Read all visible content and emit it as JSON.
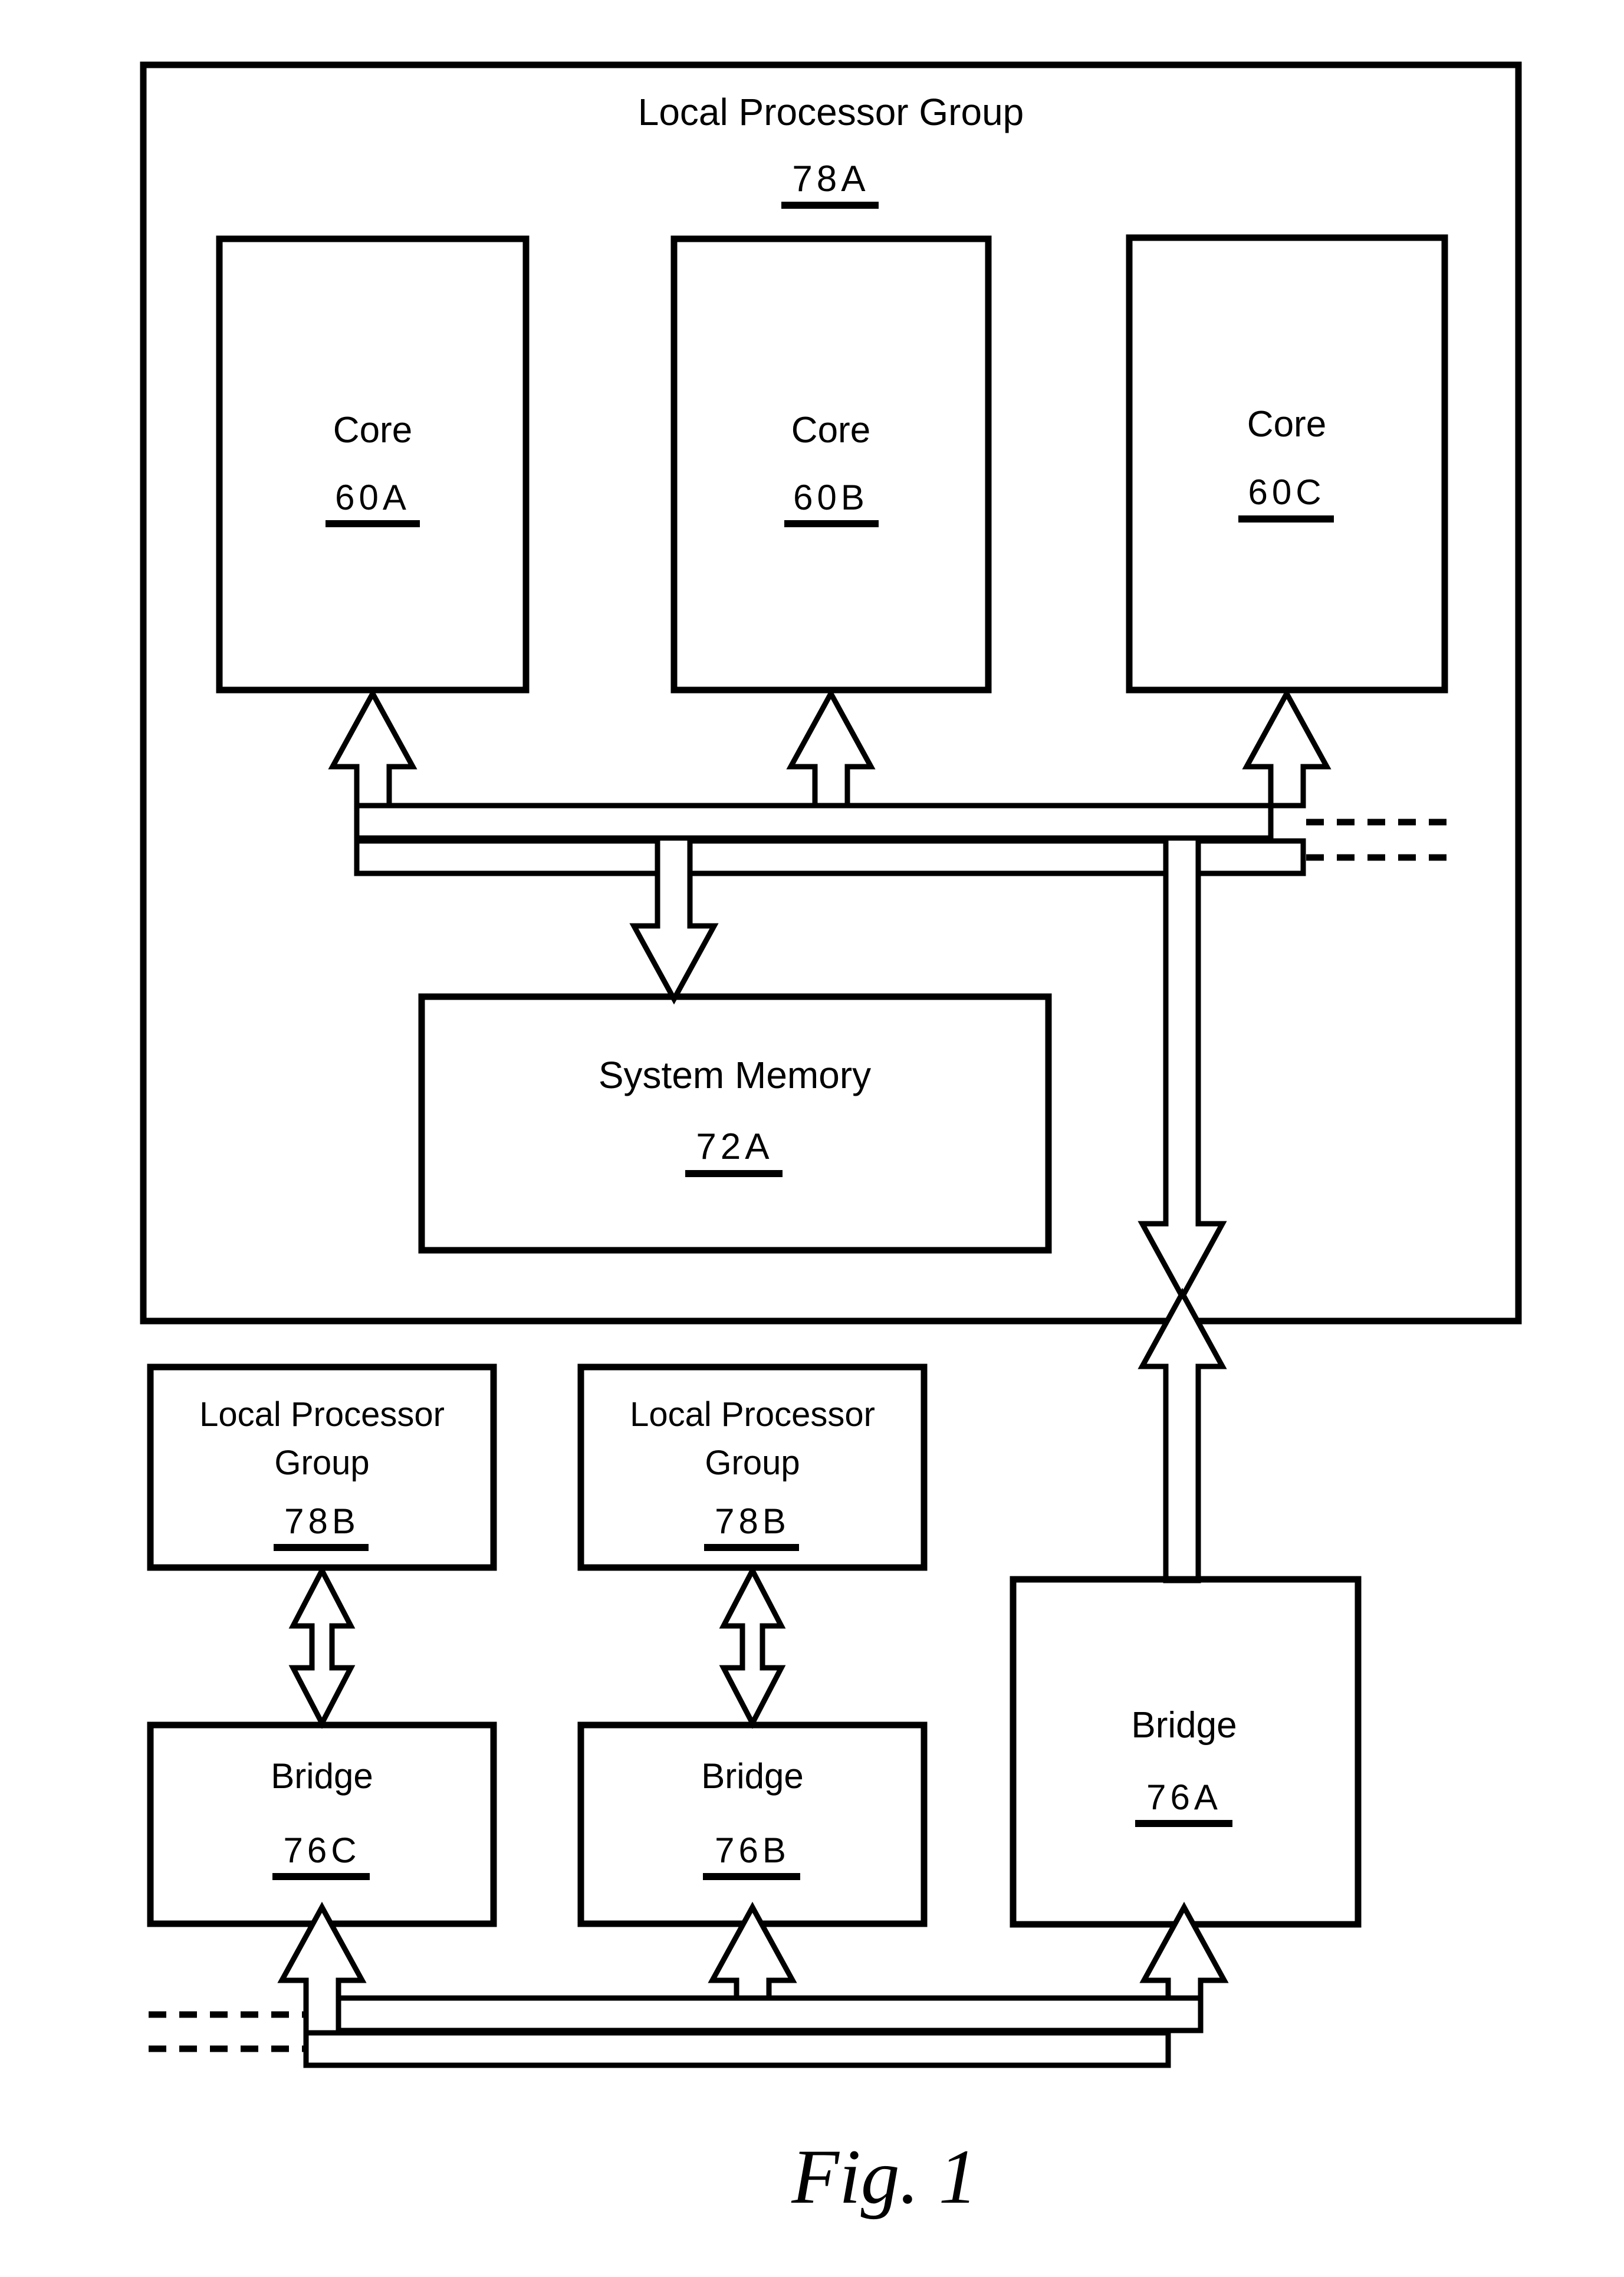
{
  "figure": {
    "caption": "Fig.  1",
    "title": "Local Processor Group",
    "title_ref": "78A"
  },
  "outer_group": {
    "name": "Local Processor Group",
    "ref": "78A"
  },
  "cores": [
    {
      "label": "Core",
      "ref": "60A"
    },
    {
      "label": "Core",
      "ref": "60B"
    },
    {
      "label": "Core",
      "ref": "60C"
    }
  ],
  "memory": {
    "label": "System Memory",
    "ref": "72A"
  },
  "processor_groups": [
    {
      "line1": "Local Processor",
      "line2": "Group",
      "ref": "78B"
    },
    {
      "line1": "Local Processor",
      "line2": "Group",
      "ref": "78B"
    }
  ],
  "bridges": [
    {
      "label": "Bridge",
      "ref": "76C"
    },
    {
      "label": "Bridge",
      "ref": "76B"
    },
    {
      "label": "Bridge",
      "ref": "76A"
    }
  ],
  "colors": {
    "ink": "#000000",
    "paper": "#ffffff"
  }
}
